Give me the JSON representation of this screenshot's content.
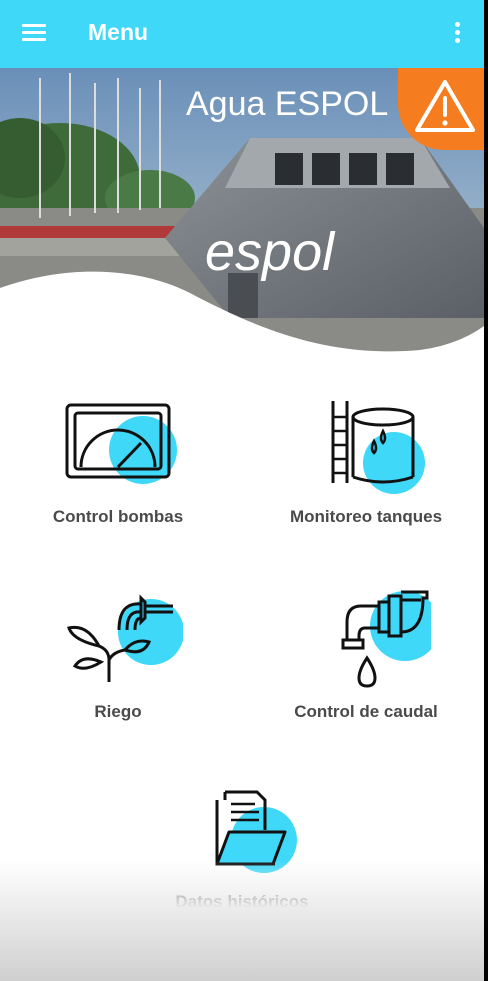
{
  "app_bar": {
    "title": "Menu",
    "menu_icon": "hamburger-menu-icon",
    "overflow_icon": "more-vert-icon",
    "color": "#3fd8f9"
  },
  "hero": {
    "logo_text": "Agua ESPOL",
    "monument_text": "espol",
    "alert_icon": "warning-triangle-icon",
    "alert_color": "#f57c1f"
  },
  "menu_items": [
    {
      "label": "Control bombas",
      "icon": "pump-gauge-icon"
    },
    {
      "label": "Monitoreo tanques",
      "icon": "water-tank-icon"
    },
    {
      "label": "Riego",
      "icon": "irrigation-plant-icon"
    },
    {
      "label": "Control de caudal",
      "icon": "faucet-pipe-icon"
    },
    {
      "label": "Datos históricos",
      "icon": "folder-documents-icon"
    }
  ],
  "accent_color": "#3fd8f9"
}
